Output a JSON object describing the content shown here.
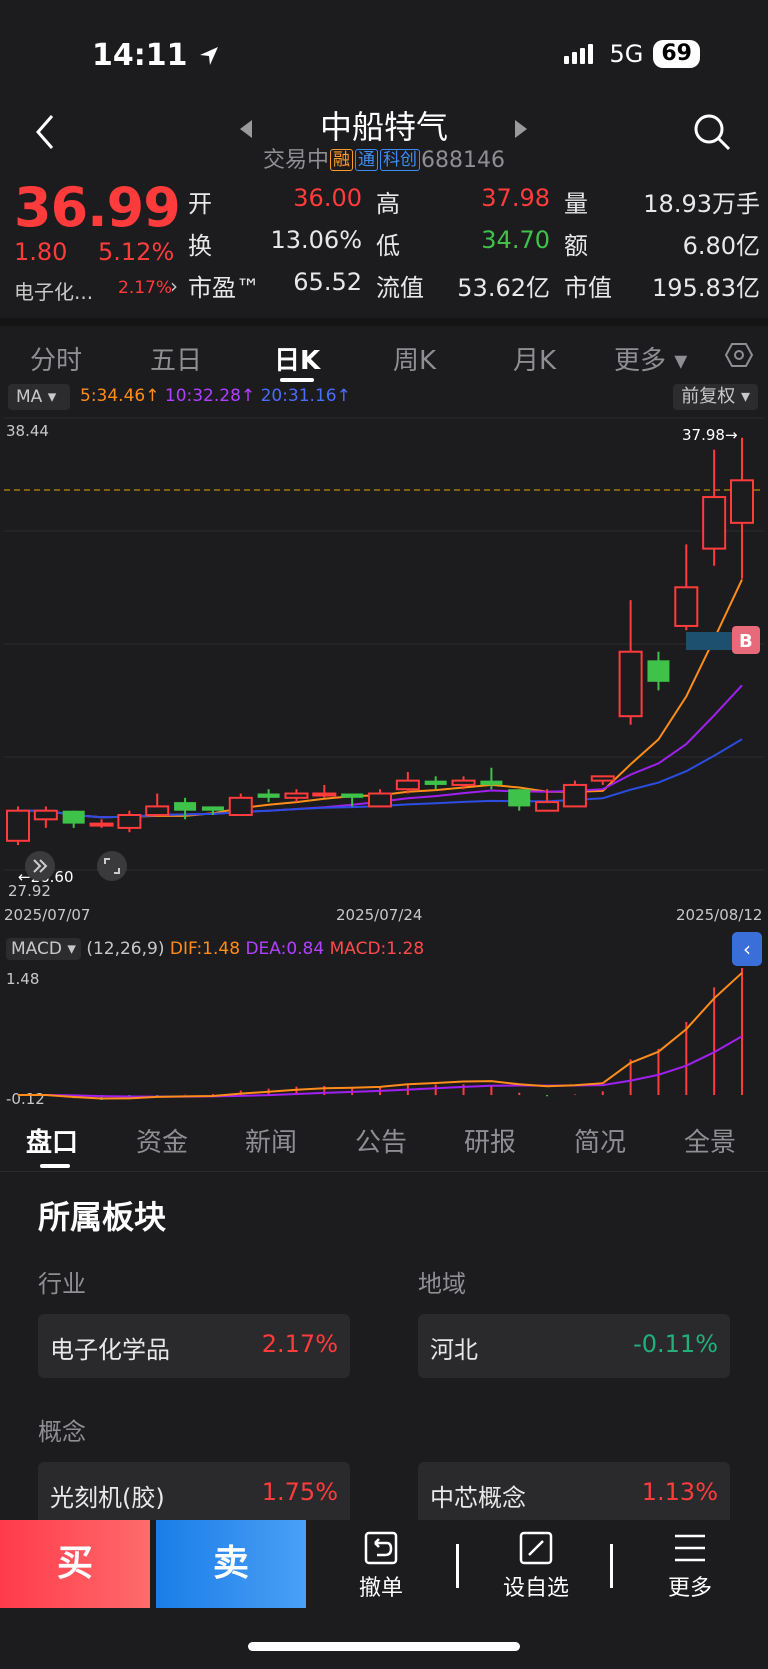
{
  "status": {
    "time": "14:11",
    "network": "5G",
    "battery": "69"
  },
  "header": {
    "title": "中船特气",
    "status": "交易中",
    "tags": [
      "融",
      "通",
      "科创"
    ],
    "code": "688146"
  },
  "quote": {
    "price": "36.99",
    "change": "1.80",
    "change_pct": "5.12%",
    "sector_name": "电子化...",
    "sector_pct": "2.17%",
    "fields": [
      {
        "label": "开",
        "value": "36.00",
        "color": "red"
      },
      {
        "label": "高",
        "value": "37.98",
        "color": "red"
      },
      {
        "label": "量",
        "value": "18.93万手",
        "color": "white"
      },
      {
        "label": "换",
        "value": "13.06%",
        "color": "white"
      },
      {
        "label": "低",
        "value": "34.70",
        "color": "green"
      },
      {
        "label": "额",
        "value": "6.80亿",
        "color": "white"
      },
      {
        "label": "市盈™",
        "value": "65.52",
        "color": "white"
      },
      {
        "label": "流值",
        "value": "53.62亿",
        "color": "white"
      },
      {
        "label": "市值",
        "value": "195.83亿",
        "color": "white"
      }
    ]
  },
  "chart_tabs": [
    "分时",
    "五日",
    "日K",
    "周K",
    "月K",
    "更多 ▾"
  ],
  "active_chart_tab": "日K",
  "ma_bar": {
    "select": "MA ▾",
    "ma5": "5:34.46↑",
    "ma10": "10:32.28↑",
    "ma20": "20:31.16↑",
    "adjust": "前复权 ▾"
  },
  "chart_data": {
    "type": "candlestick",
    "y_top_label": "38.44",
    "y_bottom_label": "27.92",
    "high_label": "37.98→",
    "low_label": "←28.60",
    "x_labels": [
      "2025/07/07",
      "2025/07/24",
      "2025/08/12"
    ],
    "marker": "B",
    "colors": {
      "up": "#ff3b3b",
      "down": "#3fc24a",
      "ma5": "#ff8c1a",
      "ma10": "#a020f0",
      "ma20": "#2b4de0"
    },
    "candles": [
      {
        "o": 28.6,
        "c": 29.3,
        "h": 29.4,
        "l": 28.5
      },
      {
        "o": 29.1,
        "c": 29.3,
        "h": 29.4,
        "l": 28.9
      },
      {
        "o": 29.3,
        "c": 29.0,
        "h": 29.3,
        "l": 28.9
      },
      {
        "o": 29.0,
        "c": 29.0,
        "h": 29.1,
        "l": 28.9
      },
      {
        "o": 28.9,
        "c": 29.2,
        "h": 29.3,
        "l": 28.8
      },
      {
        "o": 29.2,
        "c": 29.4,
        "h": 29.7,
        "l": 29.2
      },
      {
        "o": 29.5,
        "c": 29.3,
        "h": 29.6,
        "l": 29.1
      },
      {
        "o": 29.4,
        "c": 29.3,
        "h": 29.4,
        "l": 29.2
      },
      {
        "o": 29.2,
        "c": 29.6,
        "h": 29.7,
        "l": 29.2
      },
      {
        "o": 29.7,
        "c": 29.6,
        "h": 29.8,
        "l": 29.5
      },
      {
        "o": 29.6,
        "c": 29.7,
        "h": 29.8,
        "l": 29.5
      },
      {
        "o": 29.7,
        "c": 29.7,
        "h": 29.9,
        "l": 29.6
      },
      {
        "o": 29.7,
        "c": 29.6,
        "h": 29.7,
        "l": 29.4
      },
      {
        "o": 29.4,
        "c": 29.7,
        "h": 29.8,
        "l": 29.4
      },
      {
        "o": 29.8,
        "c": 30.0,
        "h": 30.2,
        "l": 29.7
      },
      {
        "o": 30.0,
        "c": 29.9,
        "h": 30.1,
        "l": 29.8
      },
      {
        "o": 29.9,
        "c": 30.0,
        "h": 30.1,
        "l": 29.8
      },
      {
        "o": 30.0,
        "c": 29.9,
        "h": 30.3,
        "l": 29.8
      },
      {
        "o": 29.8,
        "c": 29.4,
        "h": 29.8,
        "l": 29.3
      },
      {
        "o": 29.3,
        "c": 29.5,
        "h": 29.8,
        "l": 29.3
      },
      {
        "o": 29.4,
        "c": 29.9,
        "h": 30.0,
        "l": 29.4
      },
      {
        "o": 30.0,
        "c": 30.1,
        "h": 30.1,
        "l": 29.9
      },
      {
        "o": 31.5,
        "c": 33.0,
        "h": 34.2,
        "l": 31.3
      },
      {
        "o": 32.8,
        "c": 32.3,
        "h": 33.0,
        "l": 32.1
      },
      {
        "o": 33.6,
        "c": 34.5,
        "h": 35.5,
        "l": 33.5
      },
      {
        "o": 35.4,
        "c": 36.6,
        "h": 37.7,
        "l": 35.0
      },
      {
        "o": 36.0,
        "c": 36.99,
        "h": 37.98,
        "l": 34.7
      }
    ]
  },
  "macd": {
    "select": "MACD ▾",
    "params": "(12,26,9)",
    "dif": "DIF:1.48",
    "dea": "DEA:0.84",
    "macd": "MACD:1.28",
    "top_label": "1.48",
    "bottom_label": "-0.12"
  },
  "info_tabs": [
    "盘口",
    "资金",
    "新闻",
    "公告",
    "研报",
    "简况",
    "全景"
  ],
  "active_info_tab": "盘口",
  "section": {
    "title": "所属板块",
    "industry_label": "行业",
    "region_label": "地域",
    "concept_label": "概念",
    "industry": {
      "name": "电子化学品",
      "pct": "2.17%"
    },
    "region": {
      "name": "河北",
      "pct": "-0.11%"
    },
    "concepts": [
      {
        "name": "光刻机(胶)",
        "pct": "1.75%"
      },
      {
        "name": "中芯概念",
        "pct": "1.13%"
      }
    ]
  },
  "bottom_bar": {
    "buy": "买",
    "sell": "卖",
    "cancel": "撤单",
    "watchlist": "设自选",
    "more": "更多"
  }
}
